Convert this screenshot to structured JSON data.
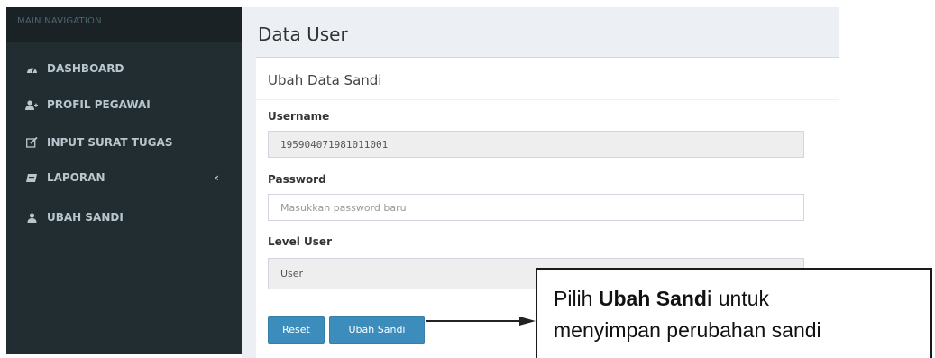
{
  "sidebar": {
    "header": "MAIN NAVIGATION",
    "items": [
      {
        "label": "DASHBOARD",
        "icon": "dashboard-icon"
      },
      {
        "label": "PROFIL PEGAWAI",
        "icon": "user-plus-icon"
      },
      {
        "label": "INPUT SURAT TUGAS",
        "icon": "edit-icon"
      },
      {
        "label": "LAPORAN",
        "icon": "book-icon",
        "chevron": "‹"
      },
      {
        "label": "UBAH SANDI",
        "icon": "user-icon"
      }
    ]
  },
  "main": {
    "page_title": "Data User",
    "box_title": "Ubah Data Sandi",
    "username": {
      "label": "Username",
      "value": "195904071981011001"
    },
    "password": {
      "label": "Password",
      "placeholder": "Masukkan password baru"
    },
    "level": {
      "label": "Level User",
      "value": "User"
    },
    "buttons": {
      "reset": "Reset",
      "submit": "Ubah Sandi"
    }
  },
  "callout": {
    "prefix": "Pilih ",
    "bold": "Ubah Sandi",
    "suffix": " untuk",
    "line2": "menyimpan perubahan sandi"
  },
  "colors": {
    "sidebar_bg": "#222d32",
    "sidebar_text": "#b8c7ce",
    "primary": "#3c8dbc",
    "content_bg": "#ecf0f5"
  }
}
